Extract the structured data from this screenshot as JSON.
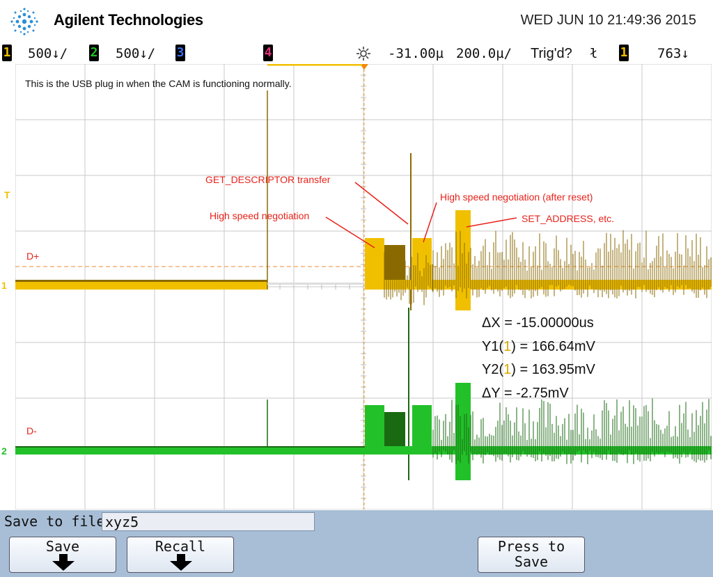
{
  "header": {
    "brand": "Agilent Technologies",
    "datetime": "WED JUN 10 21:49:36 2015"
  },
  "statusbar": {
    "channels": [
      {
        "number": "1",
        "scale": "500↓/",
        "color": "#f0c000"
      },
      {
        "number": "2",
        "scale": "500↓/",
        "color": "#22c12a"
      },
      {
        "number": "3",
        "scale": "",
        "color": "#3a6cf0"
      },
      {
        "number": "4",
        "scale": "",
        "color": "#e0307a"
      }
    ],
    "delay": "-31.00µ",
    "timebase": "200.0µ/",
    "trigger_status": "Trig'd?",
    "trigger_slope": "ł",
    "trigger_source": "1",
    "trigger_level": "763↓"
  },
  "screen": {
    "note": "This is the USB plug in when the CAM is functioning normally.",
    "channel_labels": {
      "d_plus": "D+",
      "d_minus": "D-"
    },
    "annotations": {
      "get_descriptor": "GET_DESCRIPTOR transfer",
      "hs_negotiation": "High speed negotiation",
      "hs_negotiation_after_reset": "High speed negotiation (after reset)",
      "set_address": "SET_ADDRESS, etc."
    },
    "measurements": {
      "delta_x": "ΔX = -15.00000us",
      "y1_prefix": "Y1(",
      "y1_ch": "1",
      "y1_suffix": ") = 166.64mV",
      "y2_prefix": "Y2(",
      "y2_ch": "1",
      "y2_suffix": ") = 163.95mV",
      "delta_y": "ΔY = -2.75mV"
    },
    "markers": {
      "trigger": "T",
      "ch1_ground": "1",
      "ch2_ground": "2"
    }
  },
  "softkeys": {
    "save_to_file_label": "Save to file =",
    "filename": "xyz5",
    "save": "Save",
    "recall": "Recall",
    "press_to_line1": "Press to",
    "press_to_line2": "Save"
  },
  "colors": {
    "ch1": "#f0c000",
    "ch1_dark": "#8a6a00",
    "ch2": "#22c12a",
    "ch2_dark": "#1a6a12",
    "annotation": "#e8221a",
    "softkey_bar": "#a7bed6"
  }
}
